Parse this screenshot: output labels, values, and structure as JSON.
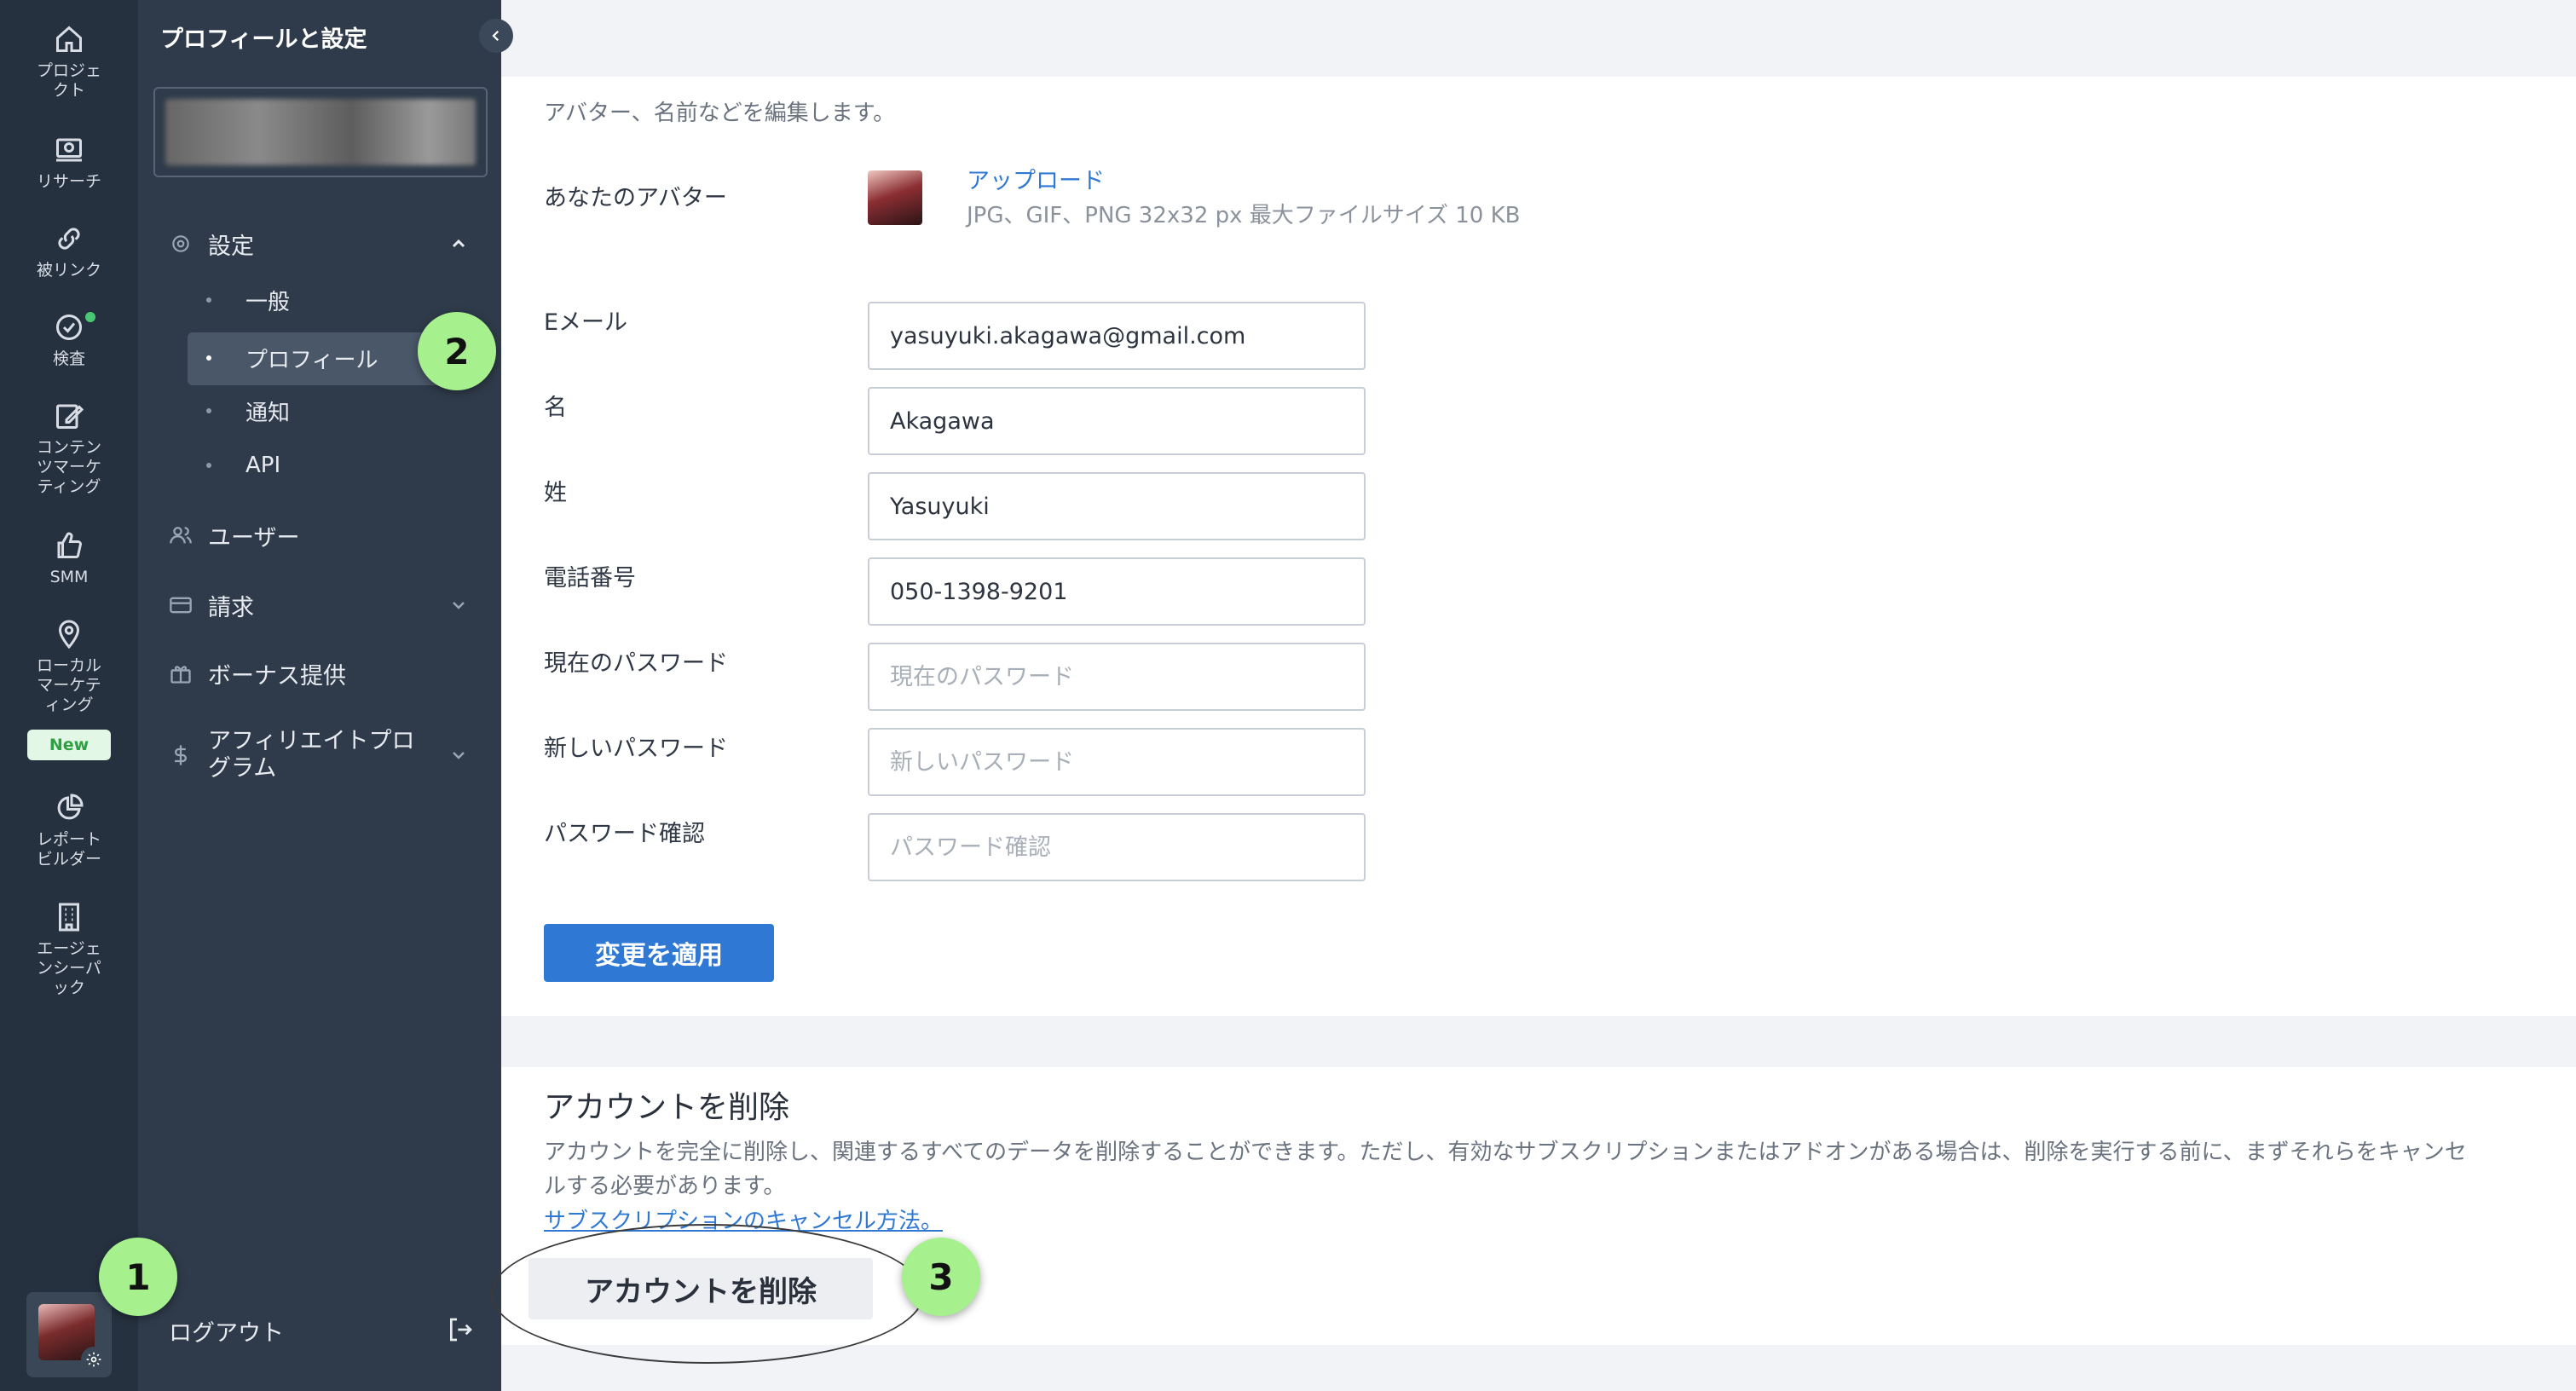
{
  "rail": {
    "items": [
      {
        "label": "プロジェ\nクト",
        "icon": "home-icon"
      },
      {
        "label": "リサーチ",
        "icon": "research-icon"
      },
      {
        "label": "被リンク",
        "icon": "link-icon"
      },
      {
        "label": "検査",
        "icon": "check-circle-icon"
      },
      {
        "label": "コンテン\nツマーケ\nティング",
        "icon": "edit-icon"
      },
      {
        "label": "SMM",
        "icon": "thumbs-up-icon"
      },
      {
        "label": "ローカル\nマーケテ\nィング",
        "icon": "location-pin-icon"
      },
      {
        "label": "レポート\nビルダー",
        "icon": "pie-chart-icon"
      },
      {
        "label": "エージェ\nンシーパ\nック",
        "icon": "building-icon"
      }
    ],
    "new_badge": "New"
  },
  "sidebar": {
    "title": "プロフィールと設定",
    "settings_label": "設定",
    "sub_items": [
      "一般",
      "プロフィール",
      "通知",
      "API"
    ],
    "users_label": "ユーザー",
    "billing_label": "請求",
    "bonus_label": "ボーナス提供",
    "affiliate_label": "アフィリエイトプロ\nグラム",
    "logout_label": "ログアウト"
  },
  "profile": {
    "description": "アバター、名前などを編集します。",
    "avatar_label": "あなたのアバター",
    "upload_link": "アップロード",
    "upload_hint": "JPG、GIF、PNG 32x32 px 最大ファイルサイズ 10 KB",
    "fields": {
      "email": {
        "label": "Eメール",
        "value": "yasuyuki.akagawa@gmail.com",
        "placeholder": ""
      },
      "first_name": {
        "label": "名",
        "value": "Akagawa",
        "placeholder": ""
      },
      "last_name": {
        "label": "姓",
        "value": "Yasuyuki",
        "placeholder": ""
      },
      "phone": {
        "label": "電話番号",
        "value": "050-1398-9201",
        "placeholder": ""
      },
      "current_password": {
        "label": "現在のパスワード",
        "value": "",
        "placeholder": "現在のパスワード"
      },
      "new_password": {
        "label": "新しいパスワード",
        "value": "",
        "placeholder": "新しいパスワード"
      },
      "confirm_password": {
        "label": "パスワード確認",
        "value": "",
        "placeholder": "パスワード確認"
      }
    },
    "apply_button": "変更を適用"
  },
  "delete_account": {
    "title": "アカウントを削除",
    "text": "アカウントを完全に削除し、関連するすべてのデータを削除することができます。ただし、有効なサブスクリプションまたはアドオンがある場合は、削除を実行する前に、まずそれらをキャンセルする必要があります。",
    "link": "サブスクリプションのキャンセル方法。",
    "button": "アカウントを削除"
  },
  "steps": [
    "1",
    "2",
    "3"
  ],
  "colors": {
    "rail_bg": "#25313f",
    "sidebar_bg": "#2f3b4a",
    "accent": "#2f78d4",
    "step_marker": "#a6f08e",
    "new_badge_text": "#2ea043"
  }
}
